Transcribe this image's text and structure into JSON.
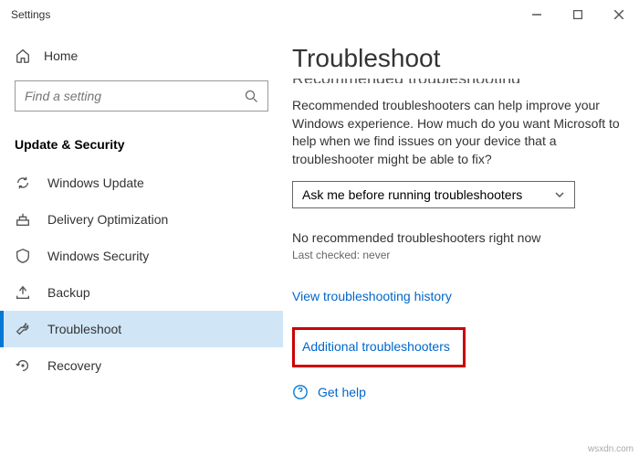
{
  "window": {
    "title": "Settings"
  },
  "sidebar": {
    "home": "Home",
    "search_placeholder": "Find a setting",
    "section": "Update & Security",
    "items": [
      {
        "label": "Windows Update"
      },
      {
        "label": "Delivery Optimization"
      },
      {
        "label": "Windows Security"
      },
      {
        "label": "Backup"
      },
      {
        "label": "Troubleshoot"
      },
      {
        "label": "Recovery"
      }
    ]
  },
  "main": {
    "title": "Troubleshoot",
    "cutoff_header": "Recommended troubleshooting",
    "description": "Recommended troubleshooters can help improve your Windows experience. How much do you want Microsoft to help when we find issues on your device that a troubleshooter might be able to fix?",
    "dropdown_value": "Ask me before running troubleshooters",
    "status": "No recommended troubleshooters right now",
    "last_checked": "Last checked: never",
    "history_link": "View troubleshooting history",
    "additional_link": "Additional troubleshooters",
    "help_link": "Get help"
  },
  "watermark": "wsxdn.com"
}
